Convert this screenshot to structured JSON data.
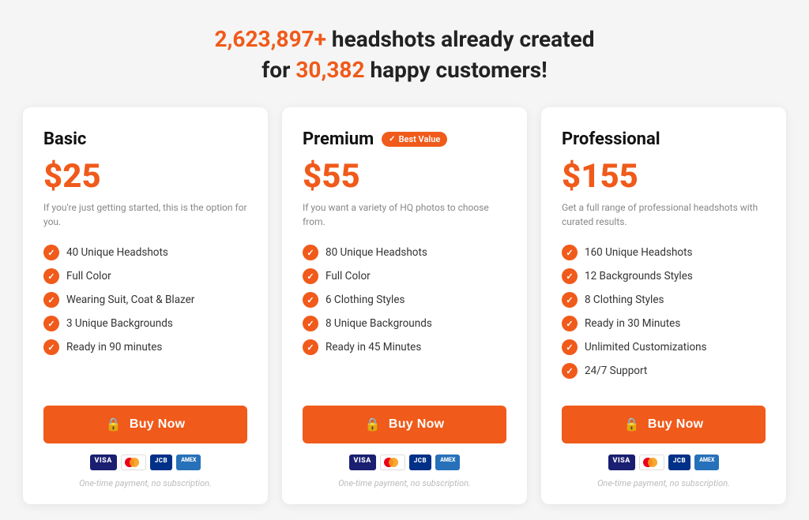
{
  "header": {
    "line1_prefix": "2,623,897+",
    "line1_suffix": " headshots already created",
    "line2_prefix": "for ",
    "line2_highlight": "30,382",
    "line2_suffix": " happy customers!"
  },
  "plans": [
    {
      "id": "basic",
      "name": "Basic",
      "price": "$25",
      "description": "If you're just getting started, this is the option for you.",
      "badge": null,
      "features": [
        "40 Unique Headshots",
        "Full Color",
        "Wearing Suit, Coat & Blazer",
        "3 Unique Backgrounds",
        "Ready in 90 minutes"
      ],
      "buy_label": "Buy Now",
      "note": "One-time payment, no subscription."
    },
    {
      "id": "premium",
      "name": "Premium",
      "price": "$55",
      "description": "If you want a variety of HQ photos to choose from.",
      "badge": "Best Value",
      "features": [
        "80 Unique Headshots",
        "Full Color",
        "6 Clothing Styles",
        "8 Unique Backgrounds",
        "Ready in 45 Minutes"
      ],
      "buy_label": "Buy Now",
      "note": "One-time payment, no subscription."
    },
    {
      "id": "professional",
      "name": "Professional",
      "price": "$155",
      "description": "Get a full range of professional headshots with curated results.",
      "badge": null,
      "features": [
        "160 Unique Headshots",
        "12 Backgrounds Styles",
        "8 Clothing Styles",
        "Ready in 30 Minutes",
        "Unlimited Customizations",
        "24/7 Support"
      ],
      "buy_label": "Buy Now",
      "note": "One-time payment, no subscription."
    }
  ]
}
